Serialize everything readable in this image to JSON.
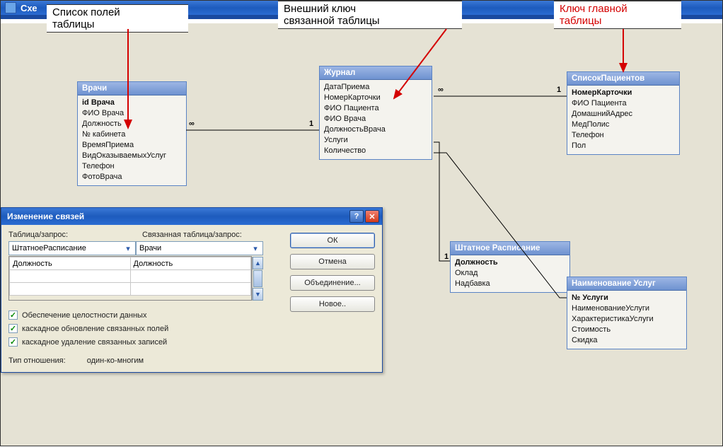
{
  "app": {
    "title": "Схе"
  },
  "tables": {
    "vrachi": {
      "title": "Врачи",
      "fields": [
        "id Врача",
        "ФИО Врача",
        "Должность",
        "№ кабинета",
        "ВремяПриема",
        "ВидОказываемыхУслуг",
        "Телефон",
        "ФотоВрача"
      ],
      "pk_index": 0
    },
    "zhurnal": {
      "title": "Журнал",
      "fields": [
        "ДатаПриема",
        "НомерКарточки",
        "ФИО Пациента",
        "ФИО Врача",
        "ДолжностьВрача",
        "Услуги",
        "Количество"
      ],
      "pk_index": -1
    },
    "spisok": {
      "title": "СписокПациентов",
      "fields": [
        "НомерКарточки",
        "ФИО Пациента",
        "ДомашнийАдрес",
        "МедПолис",
        "Телефон",
        "Пол"
      ],
      "pk_index": 0
    },
    "shtat": {
      "title": "Штатное Расписание",
      "fields": [
        "Должность",
        "Оклад",
        "Надбавка"
      ],
      "pk_index": 0
    },
    "uslugi": {
      "title": "Наименование Услуг",
      "fields": [
        "№ Услуги",
        "НаименованиеУслуги",
        "ХарактеристикаУслуги",
        "Стоимость",
        "Скидка"
      ],
      "pk_index": 0
    }
  },
  "relations": {
    "labels": {
      "one": "1",
      "many": "∞"
    }
  },
  "dialog": {
    "title": "Изменение связей",
    "label_table": "Таблица/запрос:",
    "label_related": "Связанная таблица/запрос:",
    "combo_left": "ШтатноеРасписание",
    "combo_right": "Врачи",
    "field_left": "Должность",
    "field_right": "Должность",
    "chk1": "Обеспечение целостности данных",
    "chk2": "каскадное обновление связанных полей",
    "chk3": "каскадное удаление связанных записей",
    "rel_type_label": "Тип отношения:",
    "rel_type_value": "один-ко-многим",
    "btn_ok": "ОК",
    "btn_cancel": "Отмена",
    "btn_join": "Объединение...",
    "btn_new": "Новое.."
  },
  "callouts": {
    "c1": "Список полей<br>таблицы",
    "c2": "Внешний ключ<br>связанной таблицы",
    "c3": "Ключ главной<br>таблицы"
  }
}
